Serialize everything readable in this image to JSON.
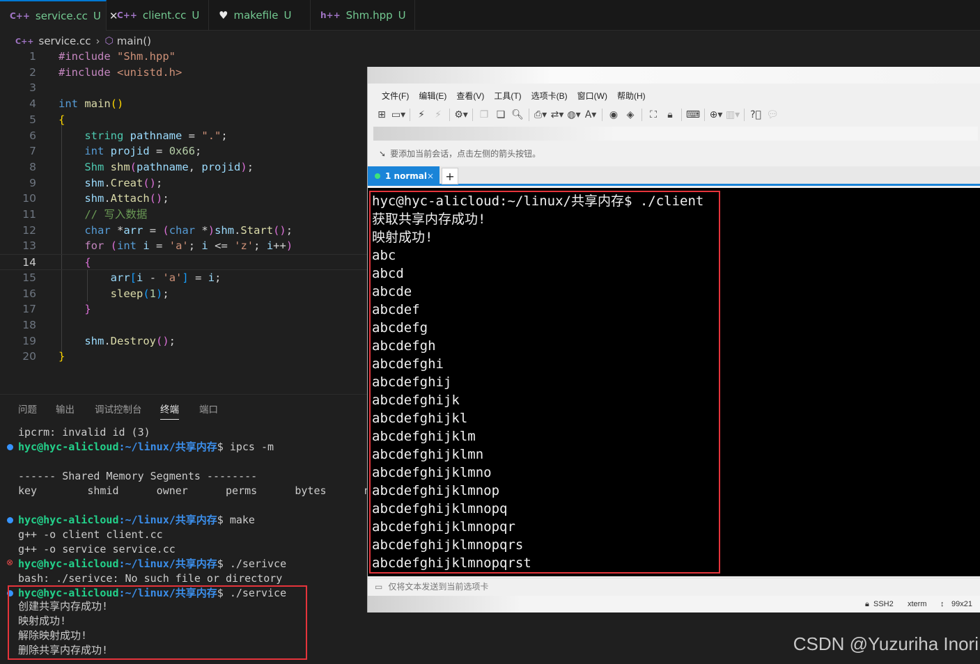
{
  "editor": {
    "tabs": [
      {
        "label": "service.cc",
        "flag": "U",
        "icon": "C++"
      },
      {
        "label": "client.cc",
        "flag": "U",
        "icon": "C++"
      },
      {
        "label": "makefile",
        "flag": "U",
        "icon": "heart-icon"
      },
      {
        "label": "Shm.hpp",
        "flag": "U",
        "icon": "h++"
      }
    ],
    "breadcrumb": {
      "file": "service.cc",
      "symbol": "main()"
    },
    "current_line": 14,
    "line_numbers": [
      "1",
      "2",
      "3",
      "4",
      "5",
      "6",
      "7",
      "8",
      "9",
      "10",
      "11",
      "12",
      "13",
      "14",
      "15",
      "16",
      "17",
      "18",
      "19",
      "20"
    ]
  },
  "panel": {
    "tabs": [
      "问题",
      "输出",
      "调试控制台",
      "终端",
      "端口"
    ],
    "active_tab": "终端"
  },
  "terminal": {
    "user": "hyc@hyc-alicloud",
    "path": ":~/linux/共享内存",
    "lines": {
      "l0": "ipcrm: invalid id (3)",
      "c1": "$ ipcs -m",
      "l2": "------ Shared Memory Segments --------",
      "l3": "key        shmid      owner      perms      bytes      n",
      "c4": "$ make",
      "l5": "g++ -o client client.cc",
      "l6": "g++ -o service service.cc",
      "c7": "$ ./serivce",
      "l8": "bash: ./serivce: No such file or directory",
      "c9": "$ ./service",
      "l10": "创建共享内存成功!",
      "l11": "映射成功!",
      "l12": "解除映射成功!",
      "l13": "删除共享内存成功!"
    }
  },
  "xshell": {
    "menu": [
      "文件(F)",
      "编辑(E)",
      "查看(V)",
      "工具(T)",
      "选项卡(B)",
      "窗口(W)",
      "帮助(H)"
    ],
    "hint": "要添加当前会话，点击左侧的箭头按钮。",
    "tab_label": "1 normal",
    "tab_close": "×",
    "tab_add": "+",
    "screen_lines": [
      "hyc@hyc-alicloud:~/linux/共享内存$ ./client",
      "获取共享内存成功!",
      "映射成功!",
      "abc",
      "abcd",
      "abcde",
      "abcdef",
      "abcdefg",
      "abcdefgh",
      "abcdefghi",
      "abcdefghij",
      "abcdefghijk",
      "abcdefghijkl",
      "abcdefghijklm",
      "abcdefghijklmn",
      "abcdefghijklmno",
      "abcdefghijklmnop",
      "abcdefghijklmnopq",
      "abcdefghijklmnopqr",
      "abcdefghijklmnopqrs",
      "abcdefghijklmnopqrst"
    ],
    "input_hint": "仅将文本发送到当前选项卡",
    "status": {
      "protocol": "SSH2",
      "term": "xterm",
      "size": "99x21"
    }
  },
  "watermark": "CSDN @Yuzuriha  Inori",
  "colors": {
    "accent": "#0078d4",
    "highlight_box": "#e5343b",
    "git_untracked": "#73c991",
    "xshell_tab": "#1a84d8"
  }
}
